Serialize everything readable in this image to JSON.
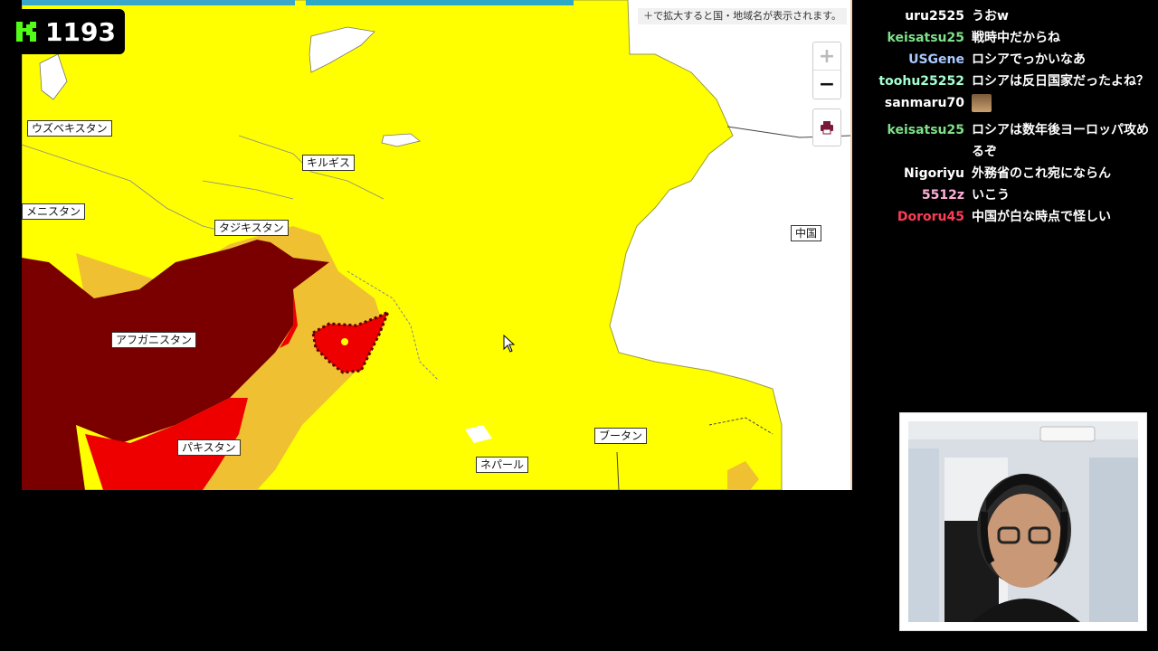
{
  "map": {
    "hint": "＋で拡大すると国・地域名が表示されます。",
    "zoom_in": "+",
    "zoom_out": "−",
    "print_icon": "printer-icon",
    "labels": {
      "uzbekistan": "ウズベキスタン",
      "kyrgyzstan": "キルギス",
      "turkmenistan": "メニスタン",
      "tajikistan": "タジキスタン",
      "afghanistan": "アフガニスタン",
      "pakistan": "パキスタン",
      "nepal": "ネパール",
      "bhutan": "ブータン",
      "china": "中国"
    },
    "colors": {
      "level1": "#ffff00",
      "level2": "#f0c033",
      "level3": "#ee0000",
      "level4": "#7a0000",
      "none": "#ffffff"
    }
  },
  "counter": {
    "value": "1193",
    "icon": "k-logo-icon"
  },
  "chat": [
    {
      "user": "uru2525",
      "color": "#ffffff",
      "text": "うおw"
    },
    {
      "user": "keisatsu25",
      "color": "#7fe08a",
      "text": "戦時中だからね"
    },
    {
      "user": "USGene",
      "color": "#a9c8ff",
      "text": "ロシアでっかいなあ"
    },
    {
      "user": "toohu25252",
      "color": "#a4ffd0",
      "text": "ロシアは反日国家だったよね？"
    },
    {
      "user": "sanmaru70",
      "color": "#ffffff",
      "text": ""
    },
    {
      "user": "keisatsu25",
      "color": "#7fe08a",
      "text": "ロシアは数年後ヨーロッパ攻めるぞ"
    },
    {
      "user": "Nigoriyu",
      "color": "#ffffff",
      "text": "外務省のこれ宛にならん"
    },
    {
      "user": "5512z",
      "color": "#ffb0d8",
      "text": "いこう"
    },
    {
      "user": "Dororu45",
      "color": "#ff3b55",
      "text": "中国が白な時点で怪しい"
    }
  ]
}
